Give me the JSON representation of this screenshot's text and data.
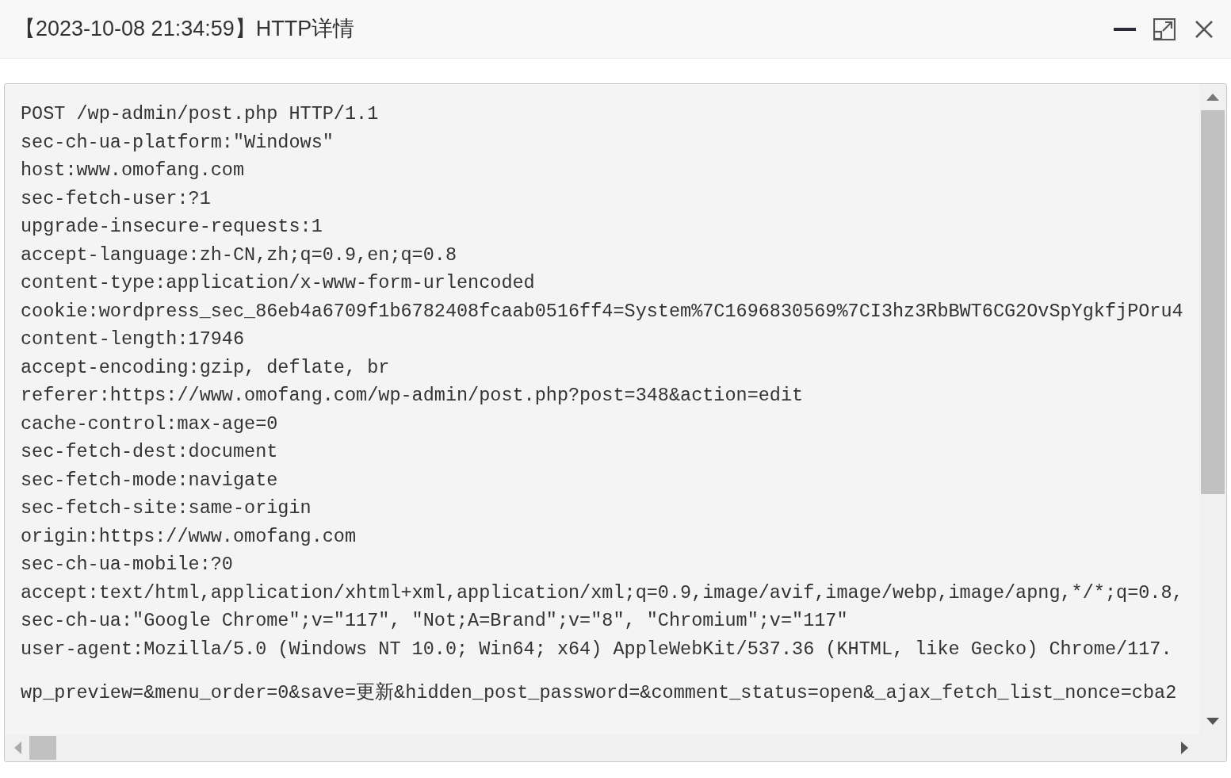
{
  "window": {
    "title": "【2023-10-08 21:34:59】HTTP详情"
  },
  "request": {
    "header_lines": [
      "POST /wp-admin/post.php HTTP/1.1",
      "sec-ch-ua-platform:\"Windows\"",
      "host:www.omofang.com",
      "sec-fetch-user:?1",
      "upgrade-insecure-requests:1",
      "accept-language:zh-CN,zh;q=0.9,en;q=0.8",
      "content-type:application/x-www-form-urlencoded",
      "cookie:wordpress_sec_86eb4a6709f1b6782408fcaab0516ff4=System%7C1696830569%7CI3hz3RbBWT6CG2OvSpYgkfjPOru4",
      "content-length:17946",
      "accept-encoding:gzip, deflate, br",
      "referer:https://www.omofang.com/wp-admin/post.php?post=348&action=edit",
      "cache-control:max-age=0",
      "sec-fetch-dest:document",
      "sec-fetch-mode:navigate",
      "sec-fetch-site:same-origin",
      "origin:https://www.omofang.com",
      "sec-ch-ua-mobile:?0",
      "accept:text/html,application/xhtml+xml,application/xml;q=0.9,image/avif,image/webp,image/apng,*/*;q=0.8,",
      "sec-ch-ua:\"Google Chrome\";v=\"117\", \"Not;A=Brand\";v=\"8\", \"Chromium\";v=\"117\"",
      "user-agent:Mozilla/5.0 (Windows NT 10.0; Win64; x64) AppleWebKit/537.36 (KHTML, like Gecko) Chrome/117."
    ],
    "body_lines": [
      "wp_preview=&menu_order=0&save=更新&hidden_post_password=&comment_status=open&_ajax_fetch_list_nonce=cba2"
    ]
  }
}
